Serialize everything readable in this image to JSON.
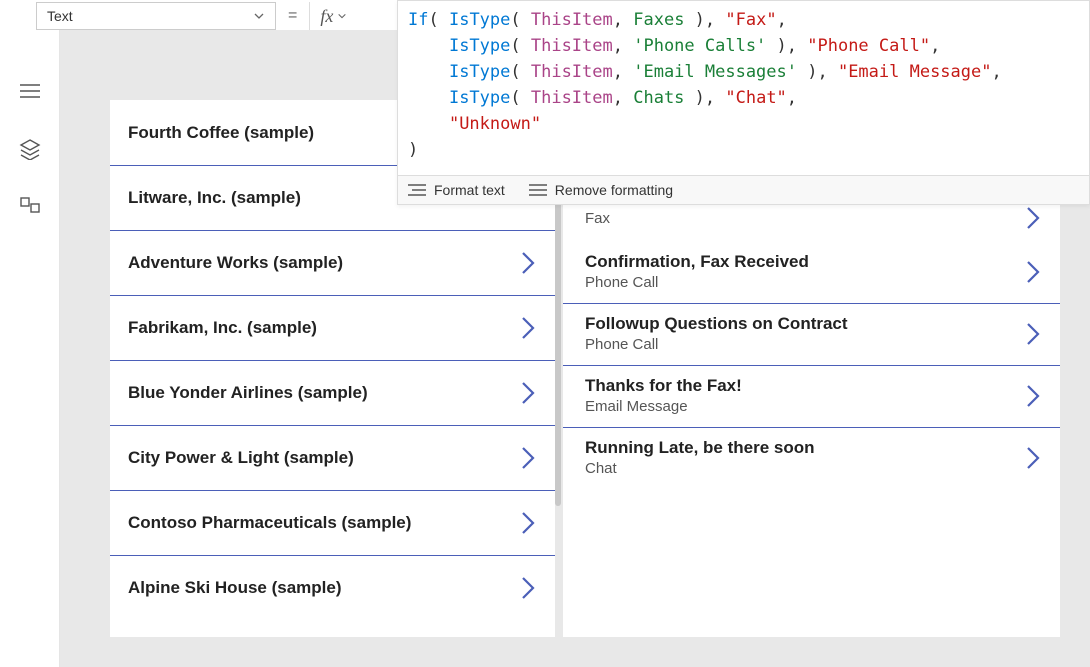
{
  "property_selector": {
    "value": "Text"
  },
  "formula": {
    "lines": [
      [
        [
          "kw",
          "If"
        ],
        [
          "pn",
          "( "
        ],
        [
          "kw",
          "IsType"
        ],
        [
          "pn",
          "( "
        ],
        [
          "id",
          "ThisItem"
        ],
        [
          "pn",
          ", "
        ],
        [
          "lit",
          "Faxes"
        ],
        [
          "pn",
          " ), "
        ],
        [
          "str",
          "\"Fax\""
        ],
        [
          "pn",
          ","
        ]
      ],
      [
        [
          "pn",
          "    "
        ],
        [
          "kw",
          "IsType"
        ],
        [
          "pn",
          "( "
        ],
        [
          "id",
          "ThisItem"
        ],
        [
          "pn",
          ", "
        ],
        [
          "lit",
          "'Phone Calls'"
        ],
        [
          "pn",
          " ), "
        ],
        [
          "str",
          "\"Phone Call\""
        ],
        [
          "pn",
          ","
        ]
      ],
      [
        [
          "pn",
          "    "
        ],
        [
          "kw",
          "IsType"
        ],
        [
          "pn",
          "( "
        ],
        [
          "id",
          "ThisItem"
        ],
        [
          "pn",
          ", "
        ],
        [
          "lit",
          "'Email Messages'"
        ],
        [
          "pn",
          " ), "
        ],
        [
          "str",
          "\"Email Message\""
        ],
        [
          "pn",
          ","
        ]
      ],
      [
        [
          "pn",
          "    "
        ],
        [
          "kw",
          "IsType"
        ],
        [
          "pn",
          "( "
        ],
        [
          "id",
          "ThisItem"
        ],
        [
          "pn",
          ", "
        ],
        [
          "lit",
          "Chats"
        ],
        [
          "pn",
          " ), "
        ],
        [
          "str",
          "\"Chat\""
        ],
        [
          "pn",
          ","
        ]
      ],
      [
        [
          "pn",
          "    "
        ],
        [
          "str",
          "\"Unknown\""
        ]
      ],
      [
        [
          "pn",
          ")"
        ]
      ]
    ]
  },
  "toolbar": {
    "format": "Format text",
    "remove": "Remove formatting"
  },
  "left_list": [
    {
      "label": "Fourth Coffee (sample)",
      "chev": false
    },
    {
      "label": "Litware, Inc. (sample)",
      "chev": false
    },
    {
      "label": "Adventure Works (sample)",
      "chev": true
    },
    {
      "label": "Fabrikam, Inc. (sample)",
      "chev": true
    },
    {
      "label": "Blue Yonder Airlines (sample)",
      "chev": true
    },
    {
      "label": "City Power & Light (sample)",
      "chev": true
    },
    {
      "label": "Contoso Pharmaceuticals (sample)",
      "chev": true
    },
    {
      "label": "Alpine Ski House (sample)",
      "chev": true
    }
  ],
  "right_partial": {
    "sub": "Fax"
  },
  "right_list": [
    {
      "title": "Confirmation, Fax Received",
      "sub": "Phone Call"
    },
    {
      "title": "Followup Questions on Contract",
      "sub": "Phone Call"
    },
    {
      "title": "Thanks for the Fax!",
      "sub": "Email Message"
    },
    {
      "title": "Running Late, be there soon",
      "sub": "Chat"
    }
  ]
}
